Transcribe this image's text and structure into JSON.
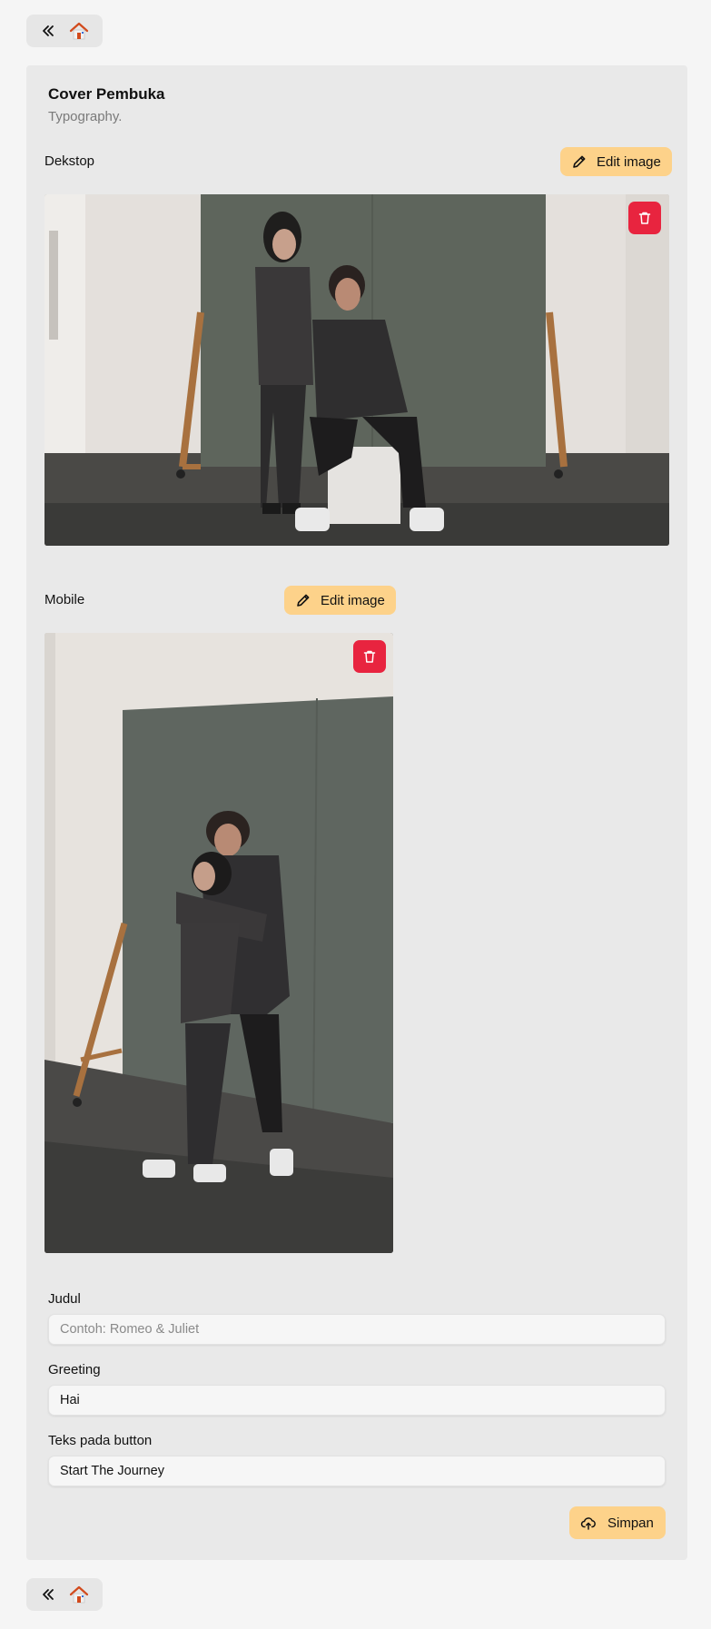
{
  "nav": {
    "back_icon": "chevrons-left-icon",
    "home_icon": "home-icon"
  },
  "card": {
    "title": "Cover Pembuka",
    "subtitle": "Typography."
  },
  "desktop": {
    "label": "Dekstop",
    "edit_label": "Edit image",
    "edit_icon": "pencil-icon",
    "delete_icon": "trash-icon"
  },
  "mobile": {
    "label": "Mobile",
    "edit_label": "Edit image",
    "edit_icon": "pencil-icon",
    "delete_icon": "trash-icon"
  },
  "form": {
    "judul": {
      "label": "Judul",
      "value": "",
      "placeholder": "Contoh: Romeo & Juliet"
    },
    "greeting": {
      "label": "Greeting",
      "value": "Hai",
      "placeholder": ""
    },
    "button_text": {
      "label": "Teks pada button",
      "value": "Start The Journey",
      "placeholder": ""
    }
  },
  "save": {
    "label": "Simpan",
    "icon": "cloud-upload-icon"
  },
  "colors": {
    "accent": "#fdd28a",
    "danger": "#e8243f",
    "card_bg": "#e9e9e9",
    "page_bg": "#f5f5f5",
    "home_roof": "#d24a1c"
  }
}
